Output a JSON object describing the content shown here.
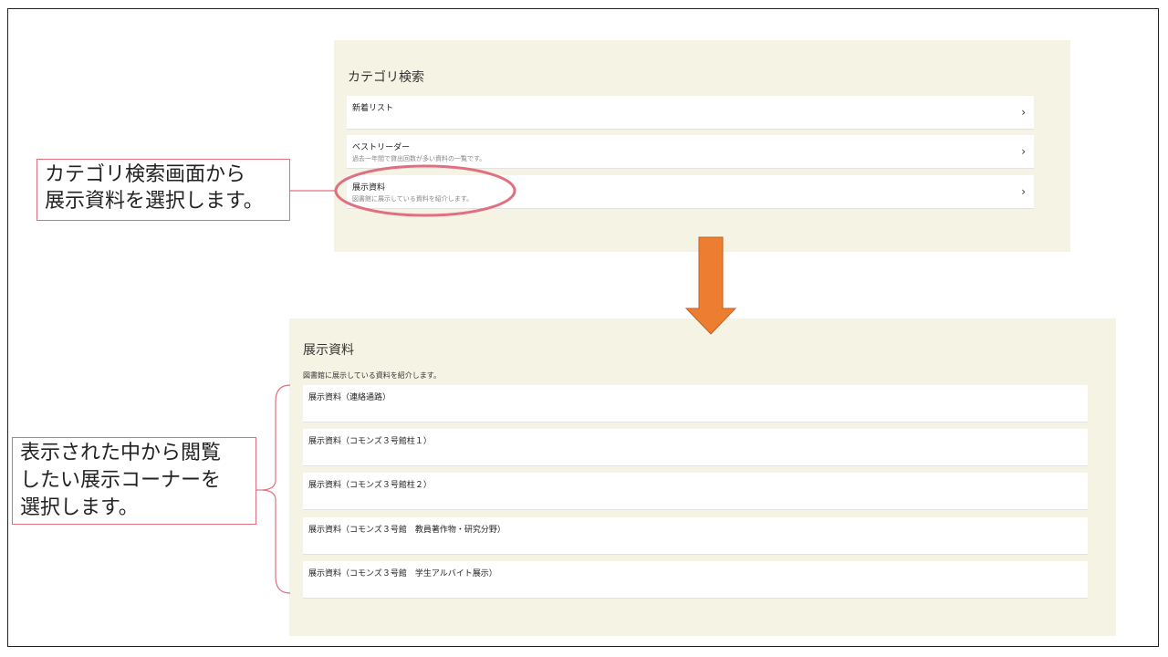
{
  "top_panel": {
    "title": "カテゴリ検索",
    "items": [
      {
        "label": "新着リスト",
        "sub": ""
      },
      {
        "label": "ベストリーダー",
        "sub": "過去一年間で貸出回数が多い資料の一覧です。"
      },
      {
        "label": "展示資料",
        "sub": "図書館に展示している資料を紹介します。"
      }
    ]
  },
  "bottom_panel": {
    "title": "展示資料",
    "description": "図書館に展示している資料を紹介します。",
    "items": [
      {
        "label": "展示資料（連絡通路）"
      },
      {
        "label": "展示資料（コモンズ３号館柱１）"
      },
      {
        "label": "展示資料（コモンズ３号館柱２）"
      },
      {
        "label": "展示資料（コモンズ３号館　教員著作物・研究分野）"
      },
      {
        "label": "展示資料（コモンズ３号館　学生アルバイト展示）"
      }
    ]
  },
  "callouts": {
    "first_line1": "カテゴリ検索画面から",
    "first_line2": "展示資料を選択します。",
    "second_line1": "表示された中から閲覧",
    "second_line2": "したい展示コーナーを",
    "second_line3": "選択します。"
  },
  "icons": {
    "chevron": "›",
    "arrow": "down-arrow-icon"
  },
  "colors": {
    "panel_bg": "#f5f3e4",
    "highlight": "#e07080",
    "arrow": "#ed7d31"
  }
}
